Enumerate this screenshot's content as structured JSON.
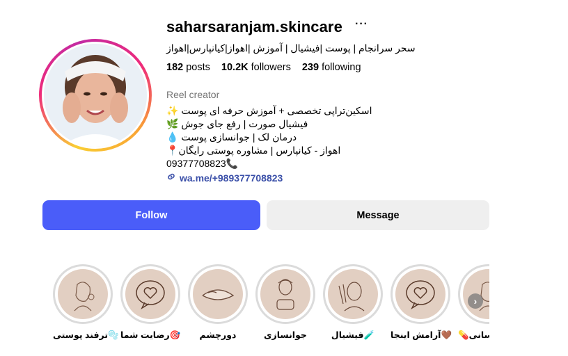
{
  "profile": {
    "username": "saharsaranjam.skincare",
    "more_icon": "···",
    "full_name": "سحر سرانجام | پوست |فیشیال | آموزش |اهواز|کیانپارس|اهواز",
    "stats": {
      "posts_count": "182",
      "posts_label": "posts",
      "followers_count": "10.2K",
      "followers_label": "followers",
      "following_count": "239",
      "following_label": "following"
    },
    "category": "Reel creator",
    "bio": [
      "✨ اسکین‌تراپی تخصصی + آموزش حرفه ای پوست",
      "🌿 فیشیال صورت | رفع جای جوش",
      "💧 درمان لک | جوانسازی پوست",
      "📍اهواز - کیانپارس | مشاوره پوستی رایگان",
      "09377708823📞"
    ],
    "link_text": "wa.me/+989377708823",
    "link_icon": "link-icon"
  },
  "actions": {
    "follow_label": "Follow",
    "message_label": "Message"
  },
  "highlights": [
    {
      "label": "ترفند پوستی🫧",
      "icon": "face-sketch"
    },
    {
      "label": "رضایت شما🎯",
      "icon": "heart-speech-bubble"
    },
    {
      "label": "دورچشم",
      "icon": "eye-mask-sketch"
    },
    {
      "label": "جوانسازی",
      "icon": "woman-portrait-sketch"
    },
    {
      "label": "فیشیال🧪",
      "icon": "facial-sketch"
    },
    {
      "label": "آرامش اینجا🤎",
      "icon": "heart-speech-bubble"
    },
    {
      "label": "رسانی💊",
      "icon": "face-sketch"
    }
  ],
  "colors": {
    "follow_button": "#4a5df9",
    "message_button": "#efefef",
    "link": "#3a4fa8",
    "highlight_bg": "#e2cfc2"
  }
}
